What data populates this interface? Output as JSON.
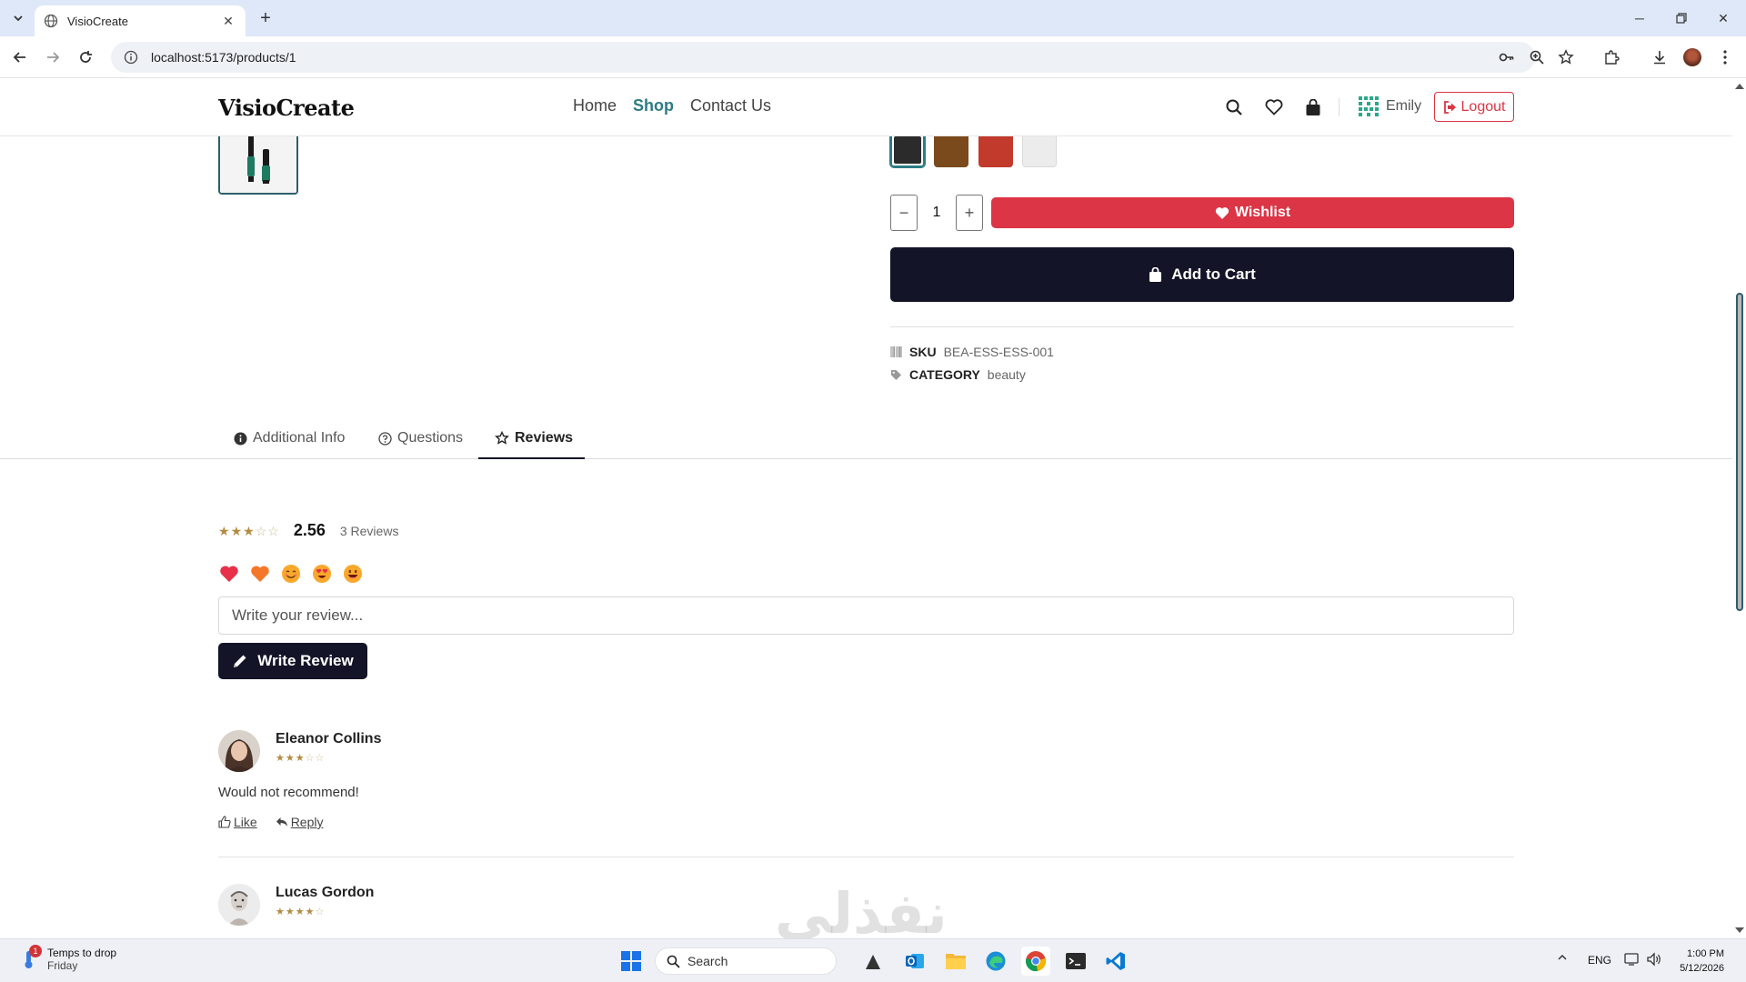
{
  "browser": {
    "tab_title": "VisioCreate",
    "url": "localhost:5173/products/1"
  },
  "site": {
    "logo": "VisioCreate",
    "nav": [
      {
        "label": "Home",
        "active": false
      },
      {
        "label": "Shop",
        "active": true
      },
      {
        "label": "Contact Us",
        "active": false
      }
    ],
    "user_name": "Emily",
    "logout_label": "Logout",
    "accent": "#2d7c84",
    "danger": "#dc3545",
    "dark": "#141428"
  },
  "product": {
    "swatches": [
      "#2b2b2b",
      "#7a4a1c",
      "#c23a2c",
      "#ececec"
    ],
    "quantity": "1",
    "wishlist_label": "Wishlist",
    "add_to_cart_label": "Add to Cart",
    "sku_key": "SKU",
    "sku_value": "BEA-ESS-ESS-001",
    "category_key": "CATEGORY",
    "category_value": "beauty"
  },
  "tabs": [
    {
      "label": "Additional Info",
      "icon": "info-icon",
      "active": false
    },
    {
      "label": "Questions",
      "icon": "question-icon",
      "active": false
    },
    {
      "label": "Reviews",
      "icon": "star-icon",
      "active": true
    }
  ],
  "reviews": {
    "average": "2.56",
    "average_stars": 3,
    "count_label": "3 Reviews",
    "reactions": [
      "heart-red-icon",
      "heart-orange-icon",
      "smile-icon",
      "heart-eyes-icon",
      "grin-icon"
    ],
    "input_placeholder": "Write your review...",
    "write_label": "Write Review",
    "like_label": "Like",
    "reply_label": "Reply",
    "items": [
      {
        "name": "Eleanor Collins",
        "stars": 3,
        "text": "Would not recommend!"
      },
      {
        "name": "Lucas Gordon",
        "stars": 4,
        "text": ""
      }
    ]
  },
  "taskbar": {
    "weather_line1": "Temps to drop",
    "weather_line2": "Friday",
    "weather_badge": "1",
    "search_label": "Search",
    "lang": "ENG",
    "time": "1:00 PM",
    "date": "5/12/2026"
  }
}
